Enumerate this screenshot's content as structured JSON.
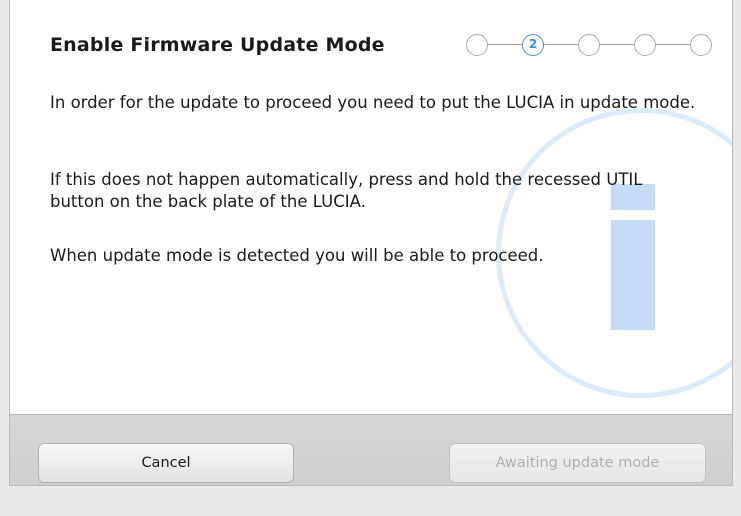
{
  "dialog": {
    "title": "Enable Firmware Update Mode",
    "steps": [
      "",
      "2",
      "",
      "",
      ""
    ],
    "active_step": 2,
    "paragraphs": [
      "In order for the update to proceed you need to put the LUCIA in update mode.",
      "If this does not happen automatically, press and hold the recessed UTIL button on the back plate of the LUCIA.",
      "When update mode is detected you will be able to proceed."
    ],
    "watermark_icon": "info-icon"
  },
  "footer": {
    "cancel_label": "Cancel",
    "proceed_label": "Awaiting update mode",
    "proceed_enabled": false
  },
  "colors": {
    "accent": "#3e8ee0",
    "watermark": "#c4dcf8",
    "footer": "#d3d3d3"
  }
}
